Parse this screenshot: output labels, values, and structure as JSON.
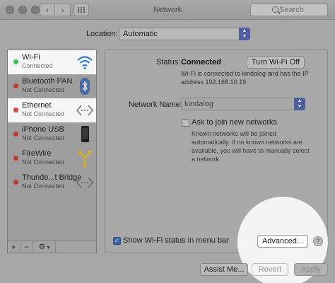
{
  "window": {
    "title": "Network"
  },
  "search": {
    "placeholder": "Search"
  },
  "location": {
    "label": "Location:",
    "value": "Automatic"
  },
  "services": [
    {
      "name": "Wi-Fi",
      "status": "Connected",
      "dot_color": "#34c84a",
      "highlighted": true,
      "icon": "wifi-icon"
    },
    {
      "name": "Bluetooth PAN",
      "status": "Not Connected",
      "dot_color": "#c0392b",
      "highlighted": false,
      "icon": "bluetooth-icon"
    },
    {
      "name": "Ethernet",
      "status": "Not Connected",
      "dot_color": "#e8403a",
      "highlighted": true,
      "icon": "ethernet-icon"
    },
    {
      "name": "iPhone USB",
      "status": "Not Connected",
      "dot_color": "#c0392b",
      "highlighted": false,
      "icon": "iphone-icon"
    },
    {
      "name": "FireWire",
      "status": "Not Connected",
      "dot_color": "#c0392b",
      "highlighted": false,
      "icon": "firewire-icon"
    },
    {
      "name": "Thunde...t Bridge",
      "status": "Not Connected",
      "dot_color": "#c0392b",
      "highlighted": false,
      "icon": "thunderbolt-bridge-icon"
    }
  ],
  "sidebar_buttons": {
    "add": "+",
    "remove": "−",
    "action": "⚙"
  },
  "status": {
    "label": "Status:",
    "value": "Connected",
    "button": "Turn Wi-Fi Off",
    "description": "Wi-Fi is connected to kindalog and has the IP address 192.168.10.19."
  },
  "network_name": {
    "label": "Network Name:",
    "value": "kindalog"
  },
  "ask_join": {
    "label": "Ask to join new networks",
    "description": "Known networks will be joined automatically. If no known networks are available, you will have to manually select a network.",
    "checked": false
  },
  "show_status": {
    "label": "Show Wi-Fi status in menu bar",
    "checked": true
  },
  "buttons": {
    "advanced": "Advanced...",
    "help": "?",
    "assist": "Assist Me...",
    "revert": "Revert",
    "apply": "Apply"
  },
  "colors": {
    "accent": "#3f63a8",
    "highlight_row": "#f6f6f6"
  }
}
